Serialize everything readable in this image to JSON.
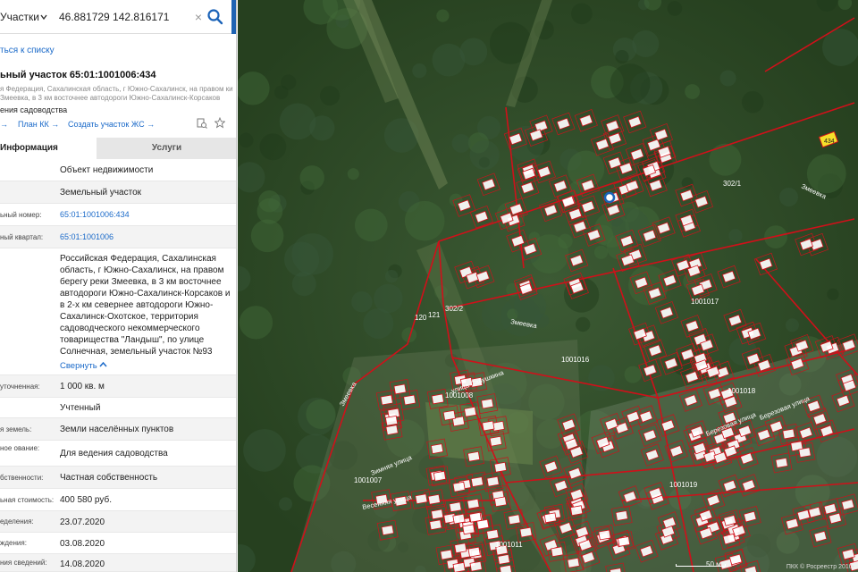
{
  "search": {
    "type_label": "Участки",
    "query": "46.881729 142.816171",
    "clear_glyph": "×"
  },
  "back_link": "ться к списку",
  "object": {
    "title": "ьный участок 65:01:1001006:434",
    "subtitle": "я Федерация, Сахалинская область, г Южно-Сахалинск, на правом ки Змеевка, в 3 км восточнее автодороги Южно-Сахалинск-Корсаков",
    "type_short": "ения садоводства"
  },
  "links": {
    "arrow0": "→",
    "plan": "План КК →",
    "create": "Создать участок ЖС →"
  },
  "tabs": {
    "info": "Информация",
    "services": "Услуги"
  },
  "rows": [
    {
      "label": "",
      "value": "Объект недвижимости"
    },
    {
      "label": "",
      "value": "Земельный участок"
    },
    {
      "label": "ьный номер:",
      "value": "65:01:1001006:434"
    },
    {
      "label": "ный квартал:",
      "value": "65:01:1001006"
    },
    {
      "label": "",
      "value": "Российская Федерация, Сахалинская область, г Южно-Сахалинск, на правом берегу реки Змеевка, в 3 км восточнее автодороги Южно-Сахалинск-Корсаков и в 2-х км севернее автодороги Южно-Сахалинск-Охотское, территория садоводческого некоммерческого товарищества \"Ландыш\", по улице Солнечная, земельный участок №93"
    },
    {
      "label": "уточненная:",
      "value": "1 000 кв. м"
    },
    {
      "label": "",
      "value": "Учтенный"
    },
    {
      "label": "я земель:",
      "value": "Земли населённых пунктов"
    },
    {
      "label": "ное ование:",
      "value": "Для ведения садоводства"
    },
    {
      "label": "бственности:",
      "value": "Частная собственность"
    },
    {
      "label": "ьная стоимость:",
      "value": "400 580 руб."
    },
    {
      "label": "еделения:",
      "value": "23.07.2020"
    },
    {
      "label": "ждения:",
      "value": "03.08.2020"
    },
    {
      "label": "ния сведений:",
      "value": "14.08.2020"
    }
  ],
  "expand_label": "Свернуть",
  "map": {
    "colors": {
      "forest": "#2e4a2b",
      "boundary": "#d0101a",
      "label_bg": "#ffffff"
    },
    "labels": {
      "block_1001017": "1001017",
      "block_1001016": "1001016",
      "block_1001018": "1001018",
      "block_1001019": "1001019",
      "block_1001008": "1001008",
      "block_1001007": "1001007",
      "block_1001011": "1001011",
      "parcel_302_1": "302/1",
      "parcel_302_2": "302/2",
      "parcel_434": "434",
      "parcel_120": "120",
      "parcel_121": "121",
      "street_zmeevka_a": "Змеевка",
      "street_zmeevka_b": "Змеевка",
      "street_zmeevka_c": "Змеевка",
      "street_savushkina": "улица Савушкина",
      "street_berezovaya_a": "Березовая улица",
      "street_berezovaya_b": "Березовая улица",
      "street_zimnyaya": "Зимняя улица",
      "street_vesennyaya": "Весенняя улица"
    },
    "scale": "50 м",
    "copyright": "ПКК © Росреестр 2010-"
  }
}
